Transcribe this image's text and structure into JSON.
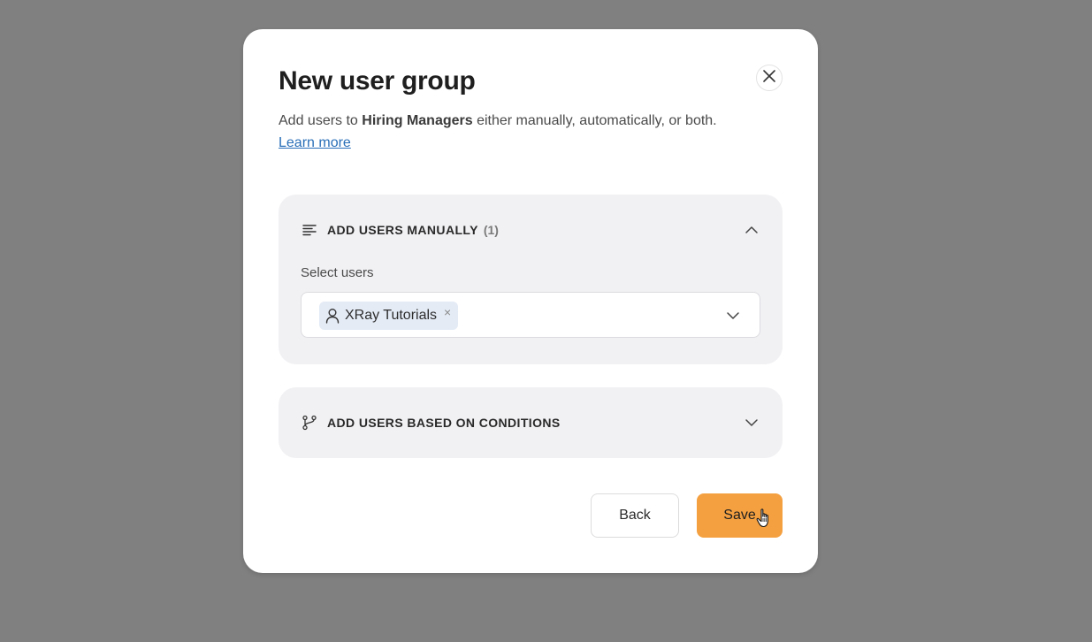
{
  "modal": {
    "title": "New user group",
    "subtitle_prefix": "Add users to ",
    "subtitle_group": "Hiring Managers",
    "subtitle_suffix": " either manually, automatically, or both.",
    "learn_more": "Learn more",
    "close_icon": "close-icon"
  },
  "manual_section": {
    "icon": "list-lines-icon",
    "title": "ADD USERS MANUALLY",
    "count": "(1)",
    "expanded": true,
    "field_label": "Select users",
    "selected_users": [
      {
        "icon": "user-icon",
        "label": "XRay Tutorials",
        "remove_glyph": "×"
      }
    ]
  },
  "conditions_section": {
    "icon": "git-branch-icon",
    "title": "ADD USERS BASED ON CONDITIONS",
    "expanded": false
  },
  "actions": {
    "back_label": "Back",
    "save_label": "Save"
  },
  "colors": {
    "backdrop": "#808080",
    "panel": "#f1f1f4",
    "chip": "#e4ebf5",
    "primary": "#f4a040",
    "link": "#2a6fb8"
  }
}
